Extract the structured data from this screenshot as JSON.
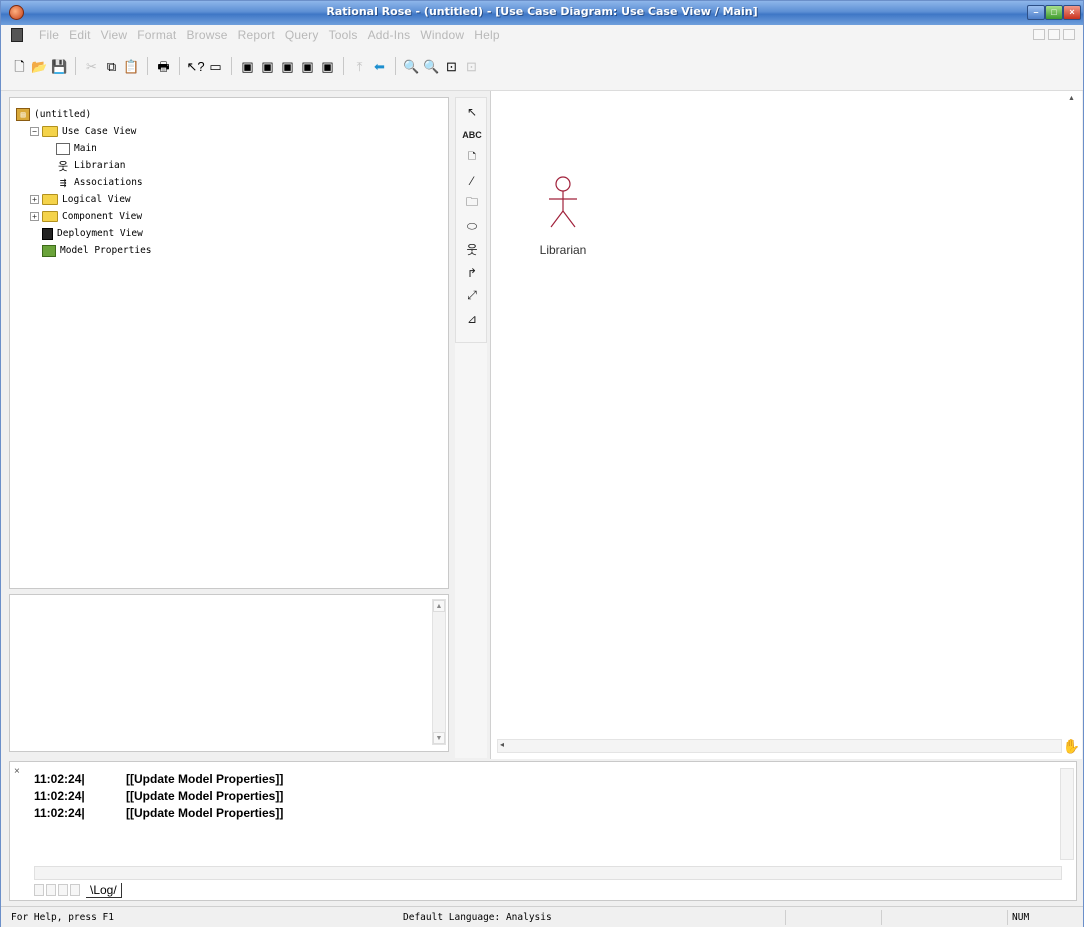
{
  "window": {
    "title": "Rational Rose - (untitled) - [Use Case Diagram: Use Case View / Main]",
    "minimize_label": "–",
    "maximize_label": "□",
    "close_label": "×"
  },
  "menu": {
    "items": [
      "File",
      "Edit",
      "View",
      "Format",
      "Browse",
      "Report",
      "Query",
      "Tools",
      "Add-Ins",
      "Window",
      "Help"
    ]
  },
  "toolbar": {
    "icons": [
      "new-file-icon",
      "open-folder-icon",
      "save-icon",
      "cut-icon",
      "copy-icon",
      "paste-icon",
      "print-icon",
      "context-help-icon",
      "view-docs-icon",
      "browse-class-diagram-icon",
      "browse-interaction-diagram-icon",
      "browse-component-diagram-icon",
      "browse-deployment-diagram-icon",
      "browse-parent-icon",
      "browse-previous-icon",
      "back-arrow-icon",
      "zoom-in-icon",
      "zoom-out-icon",
      "fit-in-window-icon",
      "undo-fit-icon"
    ]
  },
  "browser": {
    "root": "(untitled)",
    "use_case_view": "Use Case View",
    "main": "Main",
    "librarian": "Librarian",
    "associations": "Associations",
    "logical_view": "Logical View",
    "component_view": "Component View",
    "deployment_view": "Deployment View",
    "model_properties": "Model Properties",
    "collapse_glyph": "−",
    "expand_glyph": "+"
  },
  "toolbox": {
    "text_tool": "ABC"
  },
  "diagram": {
    "actor_name": "Librarian",
    "actor_color": "#a0203a"
  },
  "log": {
    "close_glyph": "×",
    "entries": [
      {
        "time": "11:02:24|",
        "message": "[[Update Model Properties]]"
      },
      {
        "time": "11:02:24|",
        "message": "[[Update Model Properties]]"
      },
      {
        "time": "11:02:24|",
        "message": "[[Update Model Properties]]"
      }
    ],
    "tab_label": "\\Log/"
  },
  "status": {
    "help": "For Help, press F1",
    "language": "Default Language: Analysis",
    "num": "NUM"
  }
}
